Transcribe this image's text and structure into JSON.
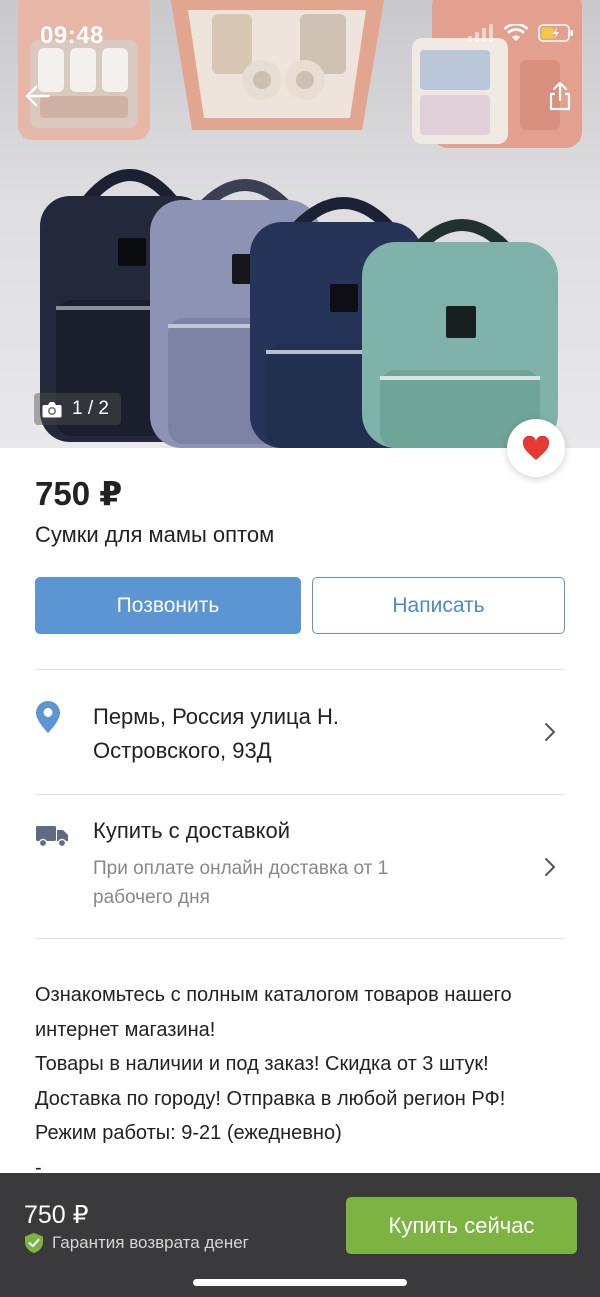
{
  "status_bar": {
    "time": "09:48"
  },
  "gallery": {
    "counter": "1 / 2"
  },
  "listing": {
    "price": "750 ₽",
    "title": "Сумки для мамы оптом"
  },
  "actions": {
    "call_label": "Позвонить",
    "write_label": "Написать"
  },
  "location": {
    "line1": "Пермь, Россия улица Н.",
    "line2": "Островского, 93Д"
  },
  "delivery": {
    "title": "Купить с доставкой",
    "subtitle_line1": "При оплате онлайн доставка от 1",
    "subtitle_line2": "рабочего дня"
  },
  "description": {
    "lines": [
      "Ознакомьтесь с полным каталогом товаров нашего",
      "интернет магазина!",
      "Товары в наличии и под заказ! Скидка от 3 штук!",
      "Доставка по городу! Отправка в любой регион РФ!",
      "Режим работы: 9-21 (ежедневно)",
      "-"
    ]
  },
  "bottom_bar": {
    "price": "750 ₽",
    "guarantee": "Гарантия возврата денег",
    "buy_label": "Купить сейчас"
  },
  "icons": {
    "back": "arrow-left-icon",
    "share": "share-icon",
    "camera": "camera-icon",
    "favorite": "heart-icon",
    "location": "map-pin-icon",
    "delivery": "truck-icon",
    "chevron": "chevron-right-icon",
    "guarantee": "shield-check-icon"
  },
  "colors": {
    "primary_blue": "#5b96d2",
    "buy_green": "#7cb342",
    "favorite_red": "#e53935",
    "bottom_bar_bg": "#3a3a3c"
  }
}
